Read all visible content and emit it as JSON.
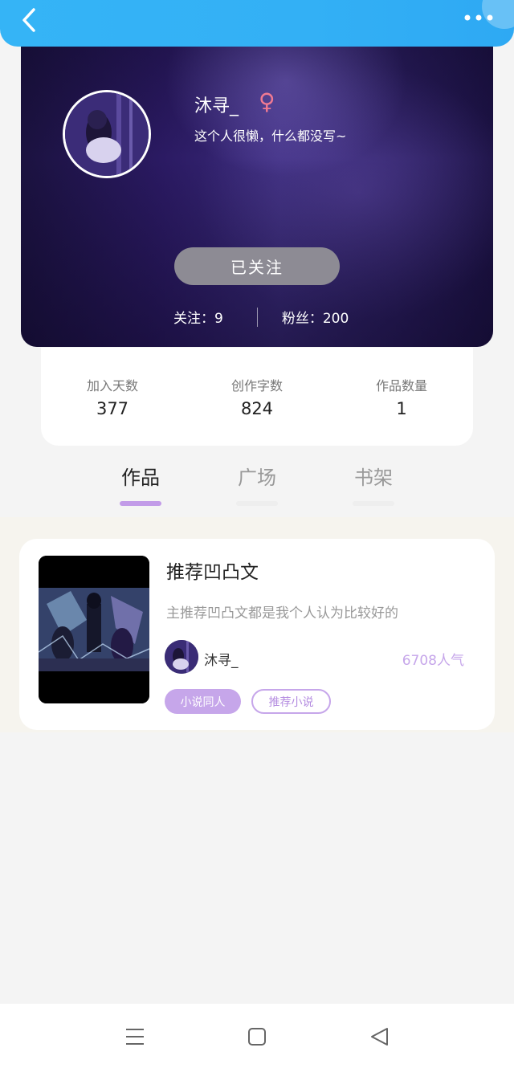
{
  "topbar": {
    "back_icon": "chevron-left-icon",
    "more_icon": "more-dots-icon",
    "bg_color": "#35b4f6"
  },
  "profile": {
    "username": "沐寻_",
    "gender_symbol": "♀",
    "bio": "这个人很懒，什么都没写~",
    "follow_button": "已关注",
    "following": "关注：9",
    "followers": "粉丝：200"
  },
  "stats": [
    {
      "label": "加入天数",
      "value": "377"
    },
    {
      "label": "创作字数",
      "value": "824"
    },
    {
      "label": "作品数量",
      "value": "1"
    }
  ],
  "tabs": [
    {
      "label": "作品",
      "active": true
    },
    {
      "label": "广场",
      "active": false
    },
    {
      "label": "书架",
      "active": false
    }
  ],
  "work": {
    "title": "推荐凹凸文",
    "description": "主推荐凹凸文都是我个人认为比较好的",
    "author": "沐寻_",
    "popularity": "6708人气",
    "tags": [
      "小说同人",
      "推荐小说"
    ]
  },
  "accent_color": "#c6a6ea",
  "navbar": {
    "icons": [
      "menu-icon",
      "home-square-icon",
      "back-triangle-icon"
    ]
  }
}
